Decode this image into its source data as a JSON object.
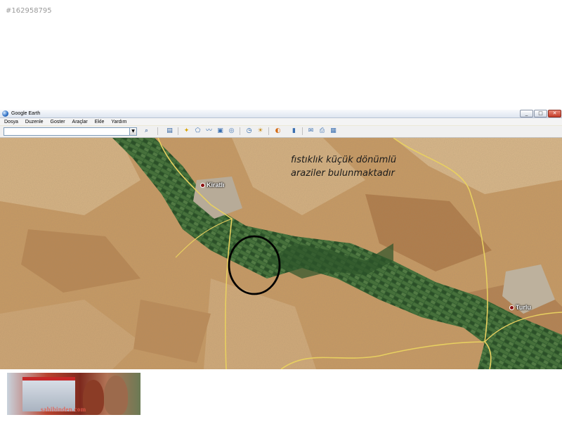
{
  "listing_id": "#162958795",
  "window": {
    "title": "Google Earth",
    "controls": [
      "_",
      "□",
      "✕"
    ]
  },
  "menu": [
    "Dosya",
    "Duzenle",
    "Goster",
    "Araçlar",
    "Ekle",
    "Yardım"
  ],
  "search": {
    "value": ""
  },
  "overlay": {
    "line1": "fıstıklık küçük dönümlü",
    "line2": "araziler bulunmaktadır"
  },
  "places": [
    {
      "name": "Kiratlı"
    },
    {
      "name": "Turlu"
    }
  ],
  "ad": {
    "caption": "sahibinden.com"
  },
  "colors": {
    "terrain": "#c89a63",
    "vegetation": "#2f5a2c",
    "roads": "#e8d060",
    "circle": "#000000"
  }
}
